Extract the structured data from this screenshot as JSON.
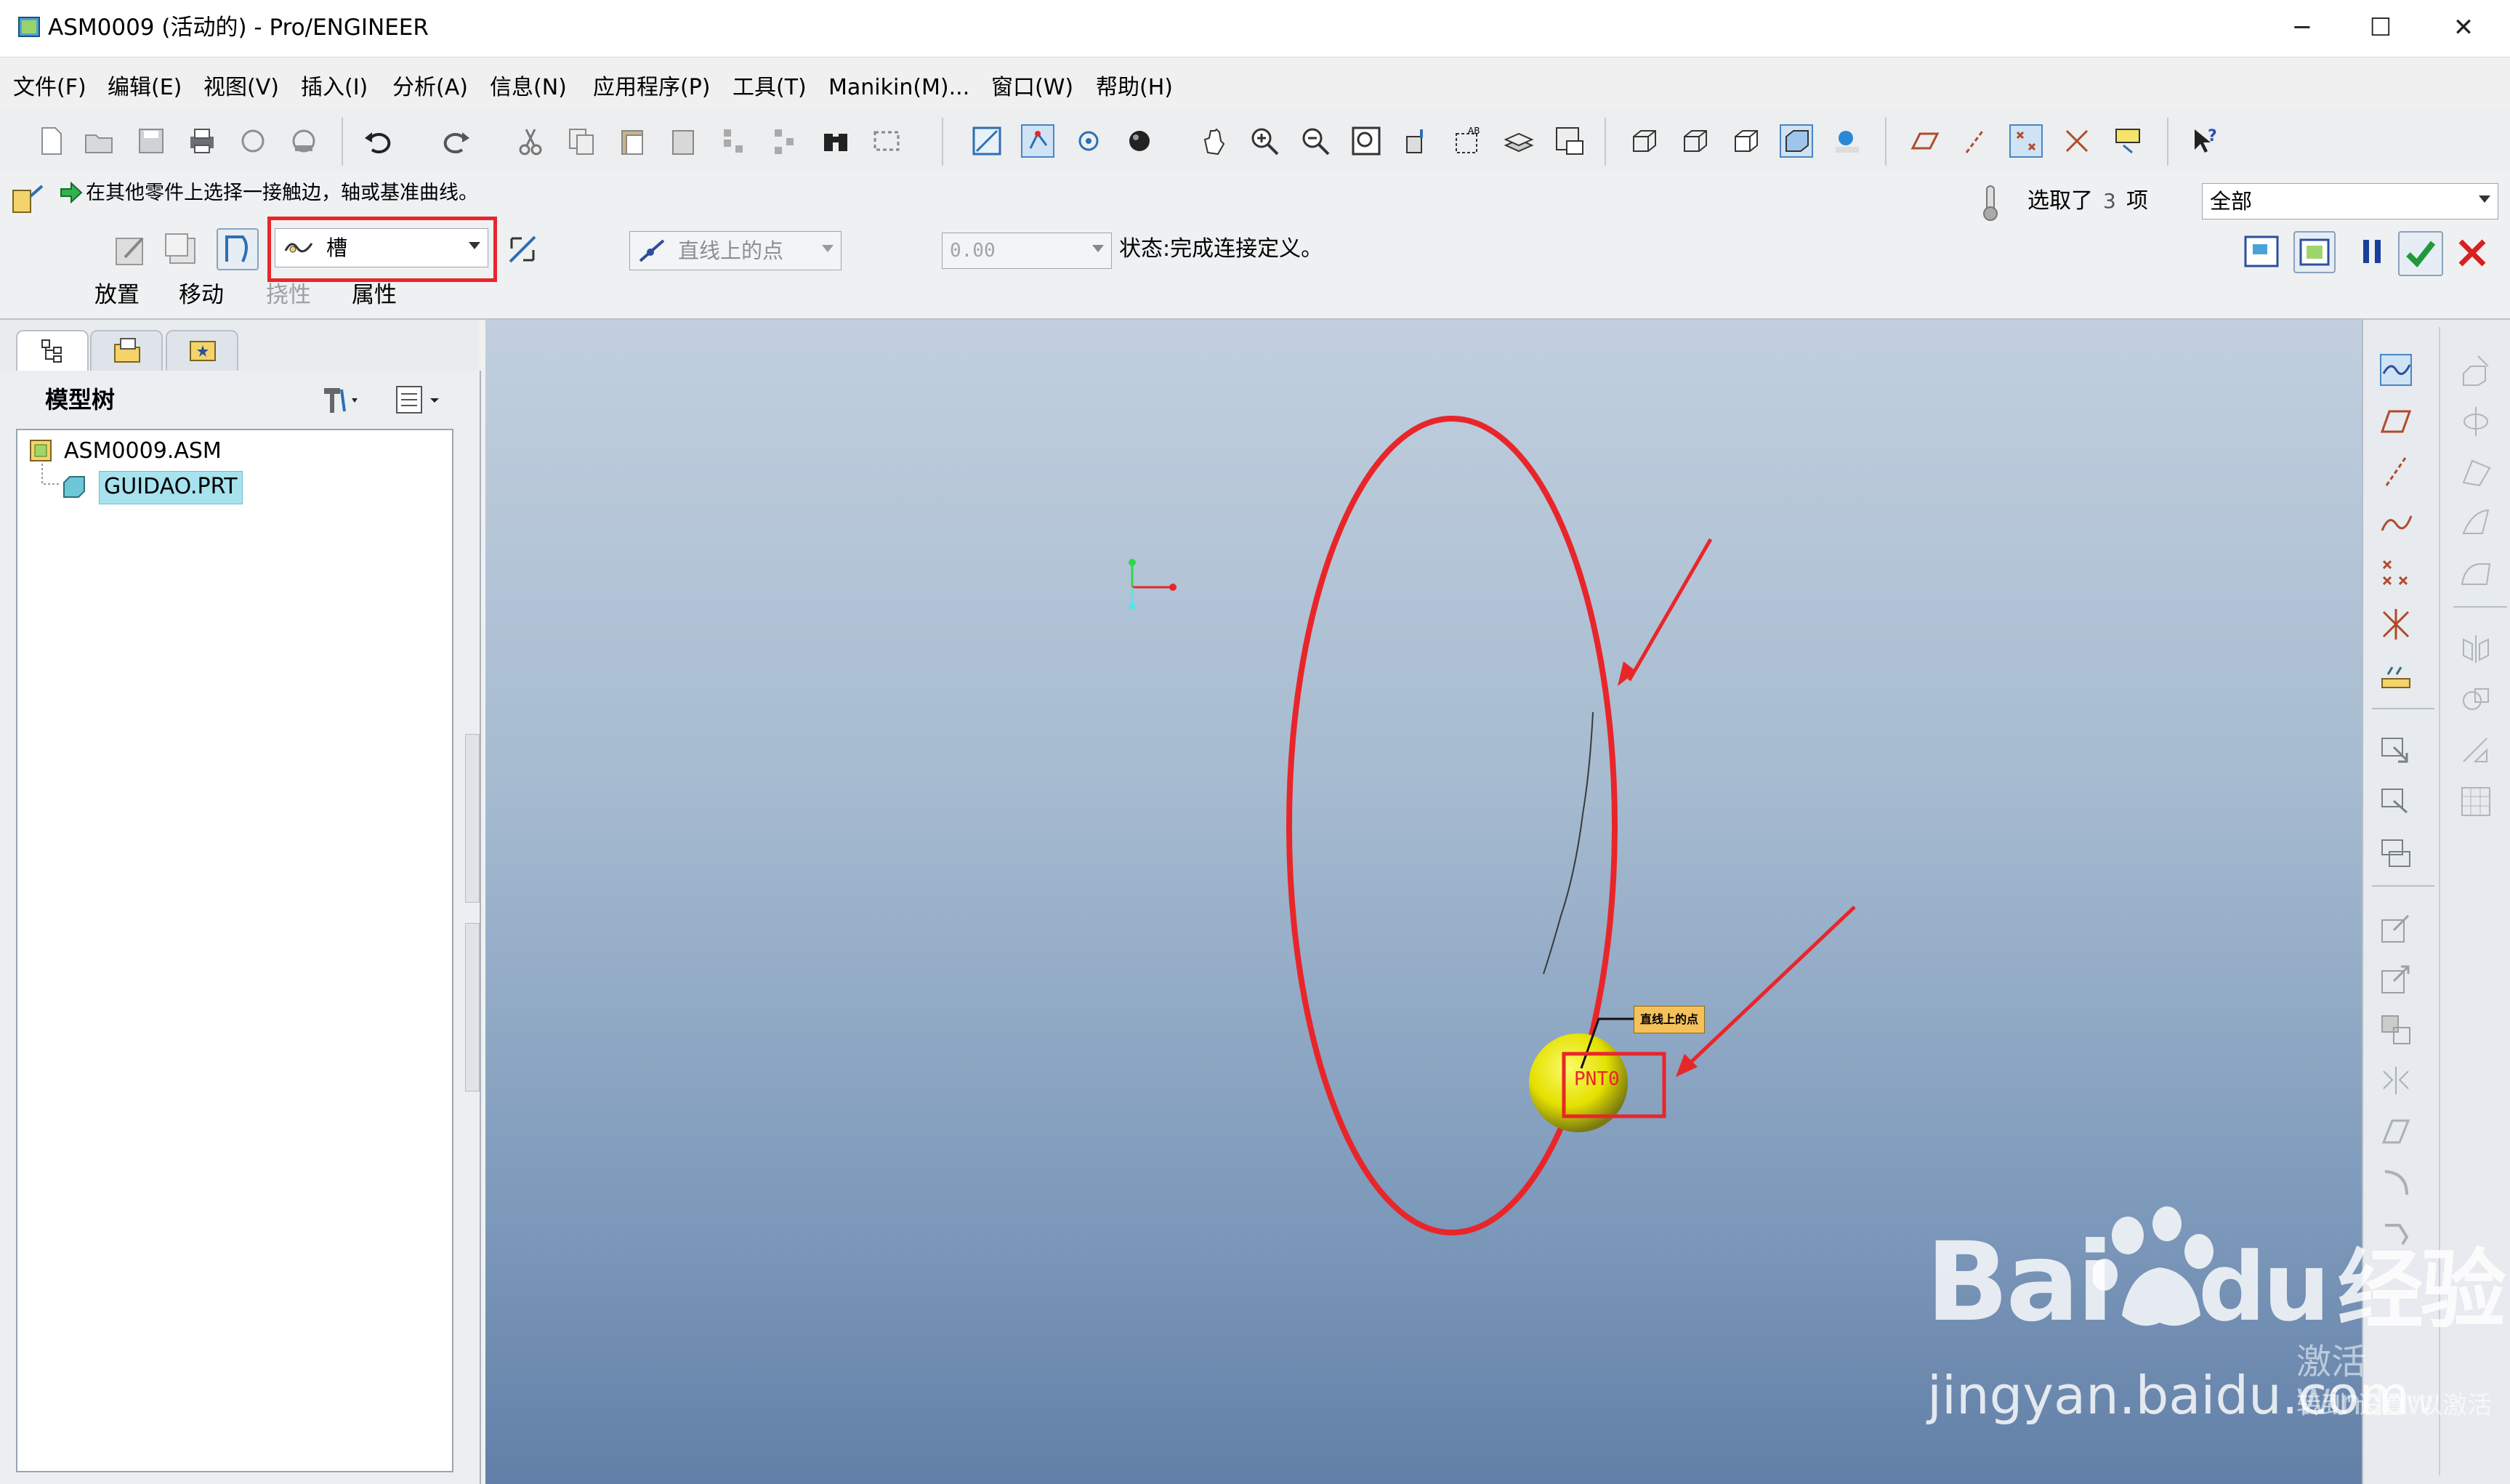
{
  "window": {
    "title": "ASM0009 (活动的) - Pro/ENGINEER",
    "minimize": "─",
    "maximize": "☐",
    "close": "✕"
  },
  "menu": [
    "文件(F)",
    "编辑(E)",
    "视图(V)",
    "插入(I)",
    "分析(A)",
    "信息(N)",
    "应用程序(P)",
    "工具(T)",
    "Manikin(M)...",
    "窗口(W)",
    "帮助(H)"
  ],
  "dashboard": {
    "prompt": "在其他零件上选择一接触边，轴或基准曲线。",
    "selected_label": "选取了",
    "selected_count": "3",
    "selected_unit": "项",
    "filter_value": "全部",
    "connection_type": "槽",
    "constraint_type": "直线上的点",
    "offset_value": "0.00",
    "status_text": "状态:完成连接定义。",
    "tabs": [
      "放置",
      "移动",
      "挠性",
      "属性"
    ]
  },
  "model_tree": {
    "title": "模型树",
    "root": "ASM0009.ASM",
    "child": "GUIDAO.PRT"
  },
  "viewport": {
    "annotation_label": "直线上的点",
    "point_label": "PNT0"
  },
  "watermark": {
    "brand_latin": "Bai",
    "brand_du": "du",
    "brand_cn": "经验",
    "url": "jingyan.baidu.com",
    "activate_title": "激活 Window",
    "activate_sub": "转到\"设置\"以激活"
  },
  "colors": {
    "annotation_red": "#e8262a",
    "sphere_yellow": "#e4e000",
    "viewport_top": "#c1cfde",
    "viewport_bottom": "#627fa7"
  }
}
